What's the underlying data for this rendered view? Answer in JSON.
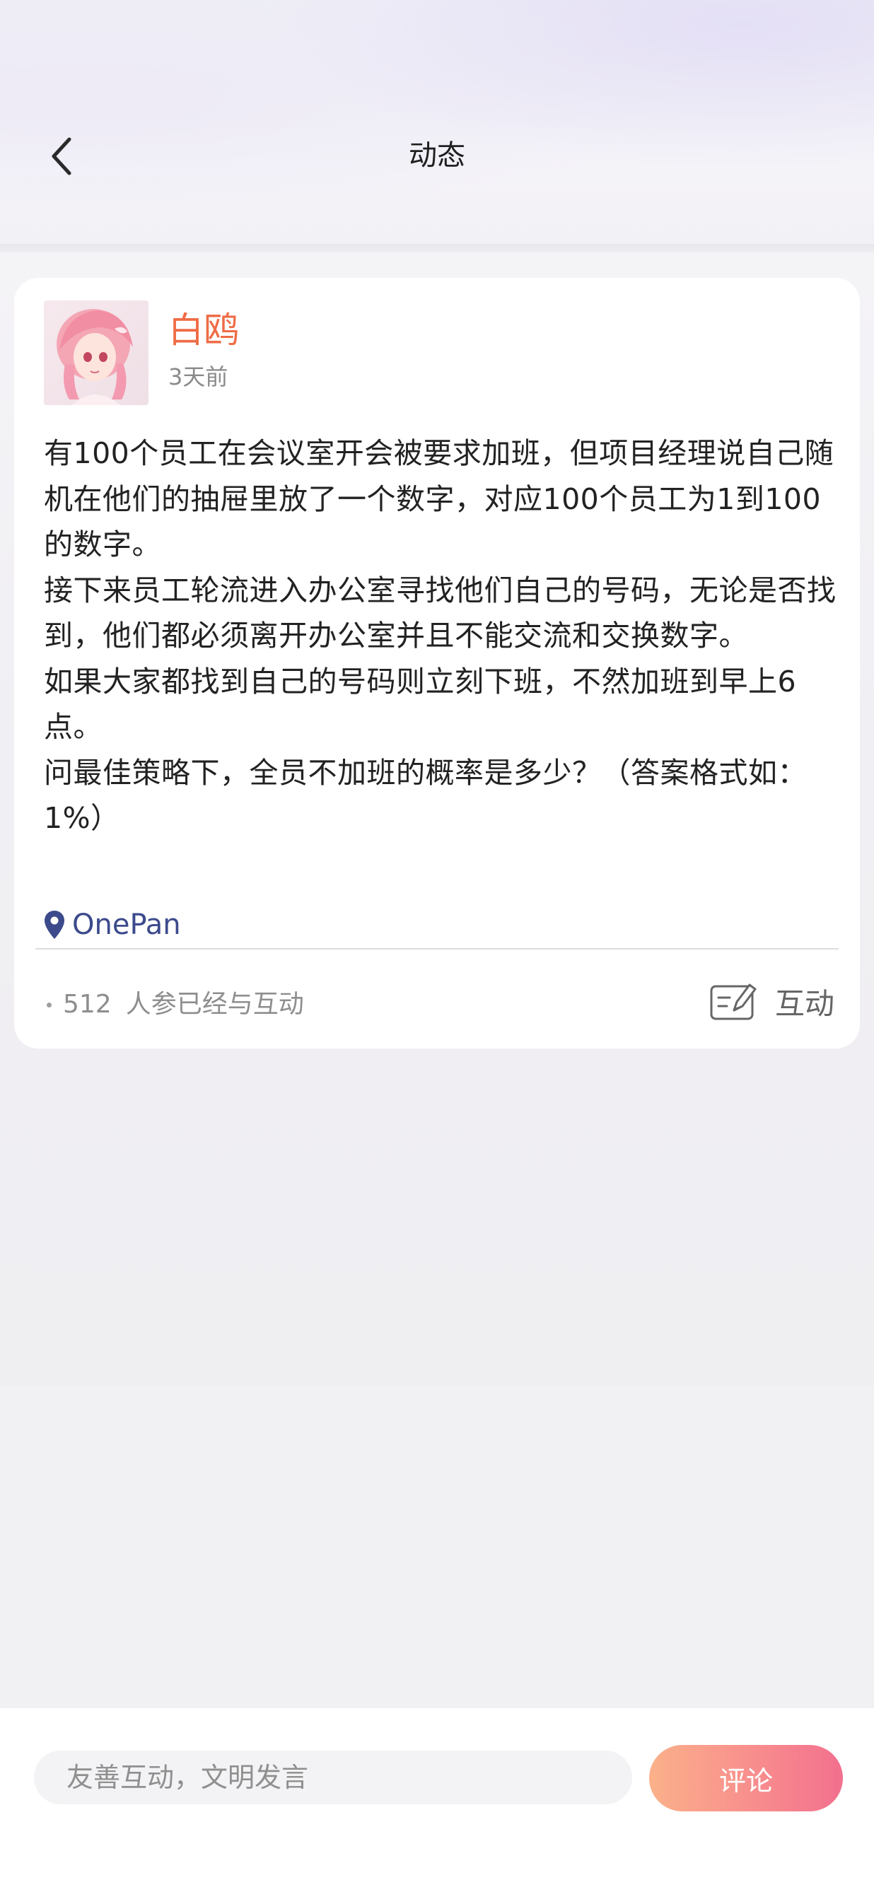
{
  "header": {
    "title": "动态",
    "back_icon": "chevron-left-icon"
  },
  "post": {
    "author": "白鸥",
    "time": "3天前",
    "body": [
      "有100个员工在会议室开会被要求加班，但项目经理说自己随机在他们的抽屉里放了一个数字，对应100个员工为1到100的数字。",
      "接下来员工轮流进入办公室寻找他们自己的号码，无论是否找到，他们都必须离开办公室并且不能交流和交换数字。",
      "如果大家都找到自己的号码则立刻下班，不然加班到早上6点。",
      "问最佳策略下，全员不加班的概率是多少？（答案格式如：1%）"
    ],
    "location": "OnePan",
    "participants_count": "512",
    "participants_text": "人参已经与互动",
    "interact_label": "互动"
  },
  "bottom_bar": {
    "comment_placeholder": "友善互动，文明发言",
    "comment_button": "评论"
  },
  "colors": {
    "author": "#ef6c46",
    "location": "#3c4a8c",
    "button_gradient_start": "#fbb18a",
    "button_gradient_end": "#f2708e"
  }
}
